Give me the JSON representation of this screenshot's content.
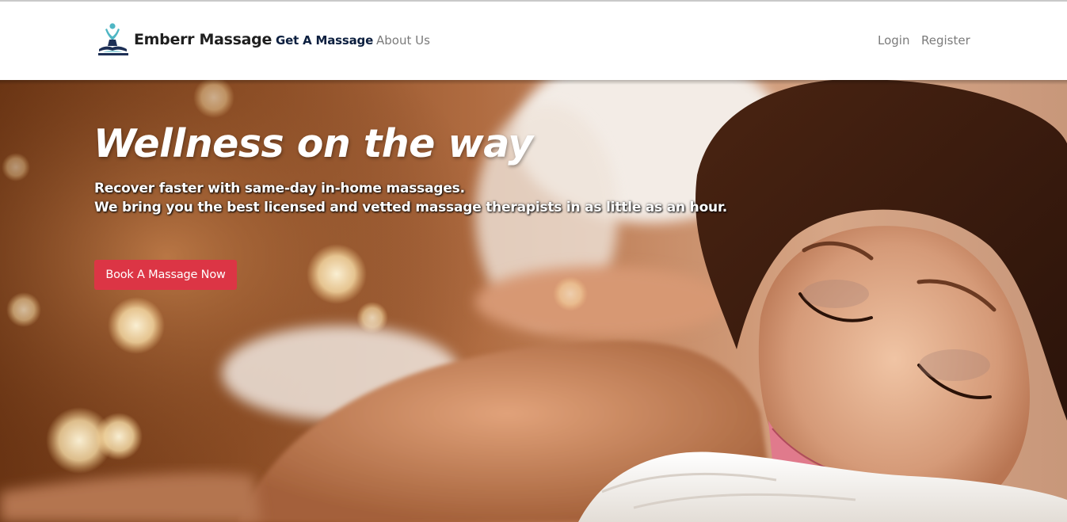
{
  "brand": {
    "name": "Emberr Massage",
    "logo_icon": "meditation-figure-logo-icon"
  },
  "nav": {
    "left": [
      {
        "label": "Get A Massage",
        "active": true
      },
      {
        "label": "About Us",
        "active": false
      }
    ],
    "right": [
      {
        "label": "Login"
      },
      {
        "label": "Register"
      }
    ]
  },
  "hero": {
    "title": "Wellness on the way",
    "subtitle_line1": "Recover faster with same-day in-home massages.",
    "subtitle_line2": "We bring you the best licensed and vetted massage therapists in as little as an hour.",
    "cta_label": "Book A Massage Now",
    "background_image": "woman receiving back massage photo"
  },
  "colors": {
    "cta": "#dc3545",
    "nav_active": "#0c1f3f",
    "nav_inactive": "#7b7b7b",
    "logo_teal": "#4fb6c4",
    "logo_navy": "#1d2f55"
  }
}
